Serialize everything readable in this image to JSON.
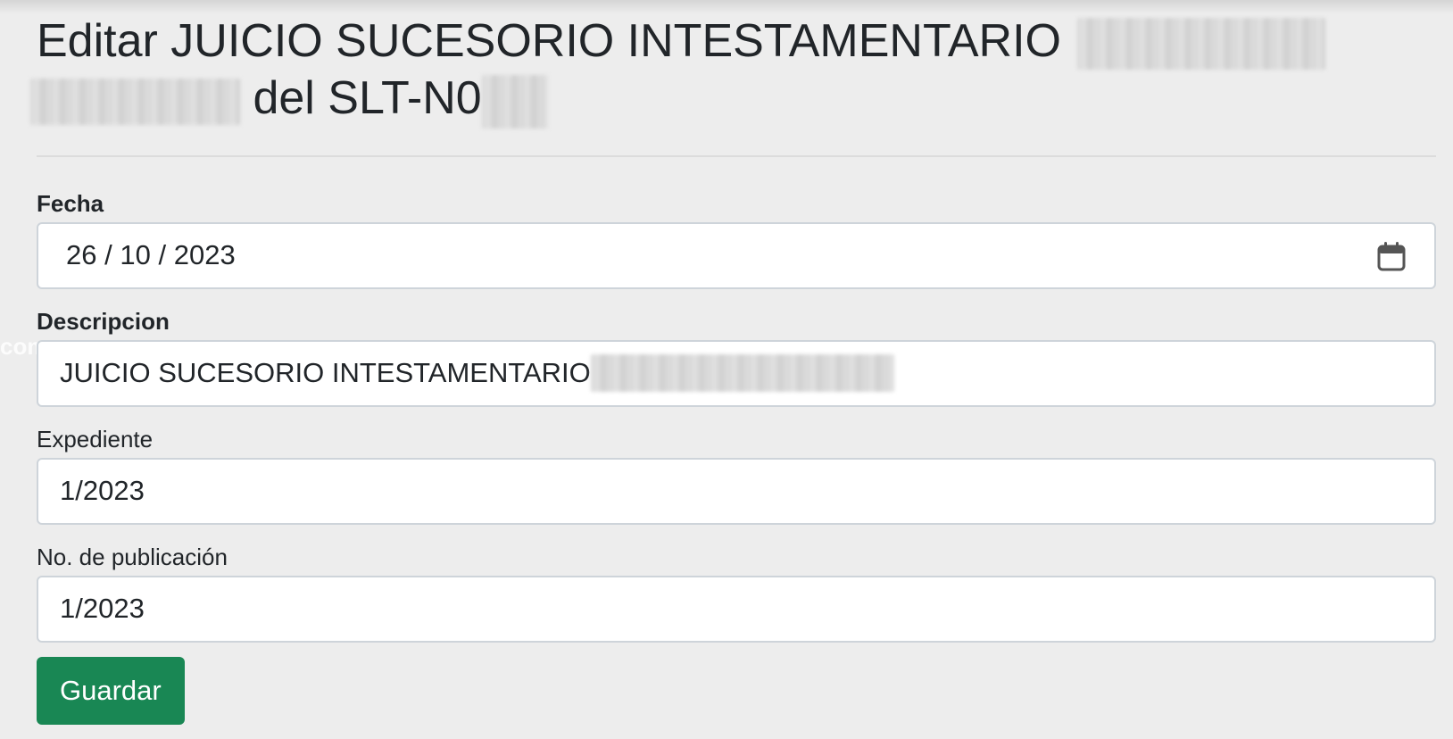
{
  "header": {
    "title_prefix": "Editar JUICIO SUCESORIO INTESTAMENTARIO",
    "title_middle": "del SLT-N0"
  },
  "form": {
    "fecha": {
      "label": "Fecha",
      "day": "26",
      "month": "10",
      "year": "2023",
      "separator": "/"
    },
    "descripcion": {
      "label": "Descripcion",
      "value": "JUICIO SUCESORIO INTESTAMENTARIO"
    },
    "expediente": {
      "label": "Expediente",
      "value": "1/2023"
    },
    "publicacion": {
      "label": "No. de publicación",
      "value": "1/2023"
    },
    "save_label": "Guardar"
  },
  "overlay": {
    "watermark": "com"
  },
  "icons": {
    "date_picker": "calendar-icon"
  },
  "colors": {
    "page_bg": "#ededed",
    "button_bg": "#198754",
    "text": "#212529",
    "input_border": "#ced4da"
  }
}
